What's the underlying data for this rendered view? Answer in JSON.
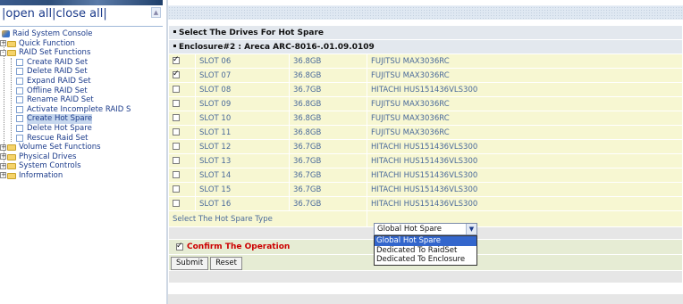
{
  "nav": {
    "open_close": "|open all|close all|",
    "tree": [
      {
        "label": "Raid System Console",
        "kind": "root"
      },
      {
        "label": "Quick Function",
        "kind": "folder",
        "toggle": "+"
      },
      {
        "label": "RAID Set Functions",
        "kind": "folder",
        "toggle": "-"
      },
      {
        "label": "Create RAID Set",
        "kind": "page"
      },
      {
        "label": "Delete RAID Set",
        "kind": "page"
      },
      {
        "label": "Expand RAID Set",
        "kind": "page"
      },
      {
        "label": "Offline RAID Set",
        "kind": "page"
      },
      {
        "label": "Rename RAID Set",
        "kind": "page"
      },
      {
        "label": "Activate Incomplete RAID S",
        "kind": "page"
      },
      {
        "label": "Create Hot Spare",
        "kind": "page",
        "selected": true
      },
      {
        "label": "Delete Hot Spare",
        "kind": "page"
      },
      {
        "label": "Rescue Raid Set",
        "kind": "page"
      },
      {
        "label": "Volume Set Functions",
        "kind": "folder",
        "toggle": "+"
      },
      {
        "label": "Physical Drives",
        "kind": "folder",
        "toggle": "+"
      },
      {
        "label": "System Controls",
        "kind": "folder",
        "toggle": "+"
      },
      {
        "label": "Information",
        "kind": "folder",
        "toggle": "+"
      }
    ]
  },
  "main": {
    "section_title": "Select The Drives For Hot Spare",
    "enclosure_title": "Enclosure#2 : Areca ARC-8016-.01.09.0109",
    "slots": [
      {
        "checked": true,
        "slot": "SLOT 06",
        "capacity": "36.8GB",
        "model": "FUJITSU MAX3036RC"
      },
      {
        "checked": true,
        "slot": "SLOT 07",
        "capacity": "36.8GB",
        "model": "FUJITSU MAX3036RC"
      },
      {
        "checked": false,
        "slot": "SLOT 08",
        "capacity": "36.7GB",
        "model": "HITACHI HUS151436VLS300"
      },
      {
        "checked": false,
        "slot": "SLOT 09",
        "capacity": "36.8GB",
        "model": "FUJITSU MAX3036RC"
      },
      {
        "checked": false,
        "slot": "SLOT 10",
        "capacity": "36.8GB",
        "model": "FUJITSU MAX3036RC"
      },
      {
        "checked": false,
        "slot": "SLOT 11",
        "capacity": "36.8GB",
        "model": "FUJITSU MAX3036RC"
      },
      {
        "checked": false,
        "slot": "SLOT 12",
        "capacity": "36.7GB",
        "model": "HITACHI HUS151436VLS300"
      },
      {
        "checked": false,
        "slot": "SLOT 13",
        "capacity": "36.7GB",
        "model": "HITACHI HUS151436VLS300"
      },
      {
        "checked": false,
        "slot": "SLOT 14",
        "capacity": "36.7GB",
        "model": "HITACHI HUS151436VLS300"
      },
      {
        "checked": false,
        "slot": "SLOT 15",
        "capacity": "36.7GB",
        "model": "HITACHI HUS151436VLS300"
      },
      {
        "checked": false,
        "slot": "SLOT 16",
        "capacity": "36.7GB",
        "model": "HITACHI HUS151436VLS300"
      }
    ],
    "hot_spare_type_label": "Select The Hot Spare Type",
    "hot_spare_type": {
      "selected": "Global Hot Spare",
      "options": [
        "Global Hot Spare",
        "Dedicated To RaidSet",
        "Dedicated To Enclosure"
      ]
    },
    "confirm": {
      "checked": true,
      "label": "Confirm The Operation"
    },
    "buttons": {
      "submit": "Submit",
      "reset": "Reset"
    }
  },
  "colors": {
    "row_bg": "#f7f7d2",
    "confirm_text": "#cc0000",
    "link_text": "#1a3a8a",
    "select_highlight": "#3366cc"
  }
}
